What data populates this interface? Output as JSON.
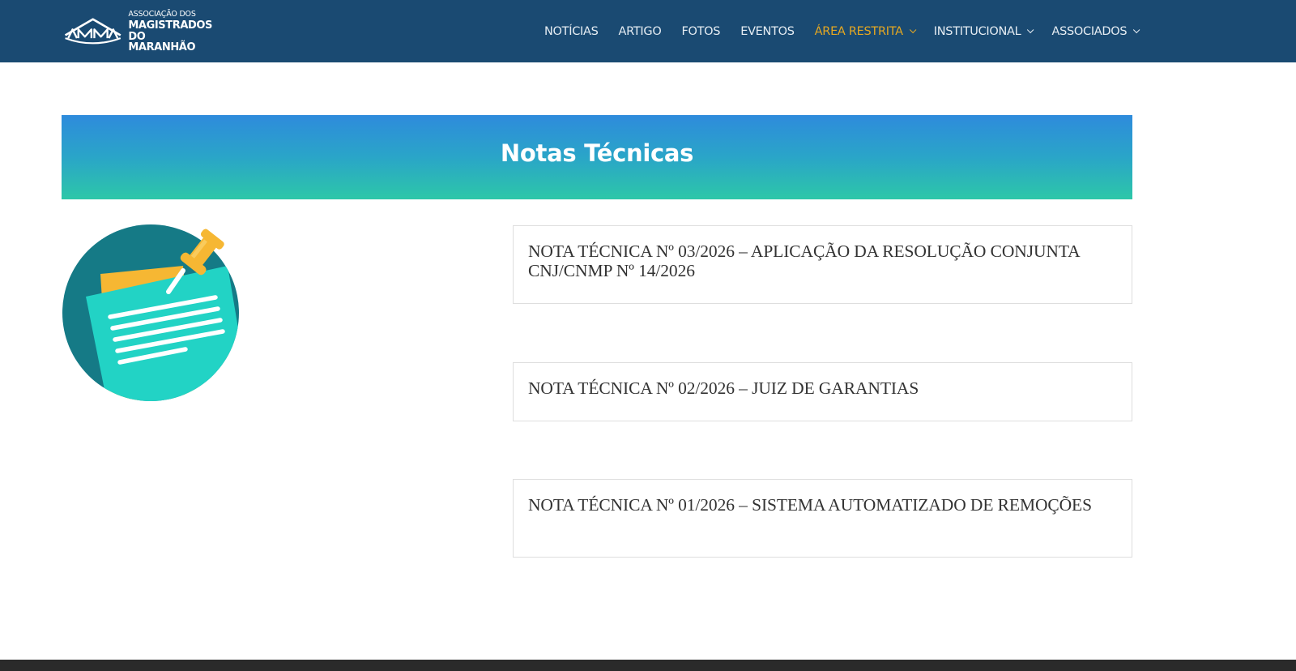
{
  "header": {
    "logo": {
      "mark": "AMMA",
      "line1": "ASSOCIAÇÃO DOS",
      "line2": "MAGISTRADOS",
      "line3": "DO MARANHÃO"
    },
    "nav": [
      {
        "label": "NOTÍCIAS",
        "has_dropdown": false
      },
      {
        "label": "ARTIGO",
        "has_dropdown": false
      },
      {
        "label": "FOTOS",
        "has_dropdown": false
      },
      {
        "label": "EVENTOS",
        "has_dropdown": false
      },
      {
        "label": "ÁREA RESTRITA",
        "has_dropdown": true,
        "active": true
      },
      {
        "label": "INSTITUCIONAL",
        "has_dropdown": true
      },
      {
        "label": "ASSOCIADOS",
        "has_dropdown": true
      }
    ]
  },
  "banner": {
    "title": "Notas Técnicas"
  },
  "illustration": {
    "icon": "pinned-note-icon"
  },
  "notes": [
    {
      "title": "NOTA TÉCNICA Nº 03/2026 – APLICAÇÃO DA RESOLUÇÃO CONJUNTA CNJ/CNMP Nº 14/2026"
    },
    {
      "title": "NOTA TÉCNICA Nº 02/2026 – JUIZ DE GARANTIAS"
    },
    {
      "title": "NOTA TÉCNICA Nº 01/2026 – SISTEMA AUTOMATIZADO DE REMOÇÕES"
    }
  ],
  "colors": {
    "header_bg": "#1a4a72",
    "nav_text": "#e6edf3",
    "nav_active": "#e6a821",
    "banner_top": "#2e8bdc",
    "banner_bottom": "#2dc7a8",
    "card_border": "#dedede",
    "footer_bg": "#2a2a2a"
  }
}
